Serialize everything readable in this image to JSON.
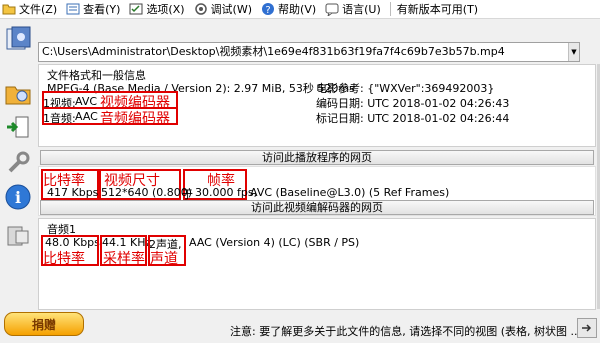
{
  "menu": {
    "file": "文件(Z)",
    "view": "查看(Y)",
    "options": "选项(X)",
    "debug": "调试(W)",
    "help": "帮助(V)",
    "language": "语言(U)",
    "update": "有新版本可用(T)"
  },
  "path": "C:\\Users\\Administrator\\Desktop\\视频素材\\1e69e4f831b63f19fa7f4c69b7e3b57b.mp4",
  "general": {
    "heading": "文件格式和一般信息",
    "format_line": "MPEG-4 (Base Media / Version 2): 2.97 MiB, 53秒 520ms",
    "movie_line": "电影参考: {\"WXVer\":369492003}",
    "video_prefix": "1视频:",
    "video_codec": "AVC",
    "video_label": "视频编码器",
    "audio_prefix": "1音频:",
    "audio_codec": "AAC",
    "audio_label": "音频编码器",
    "encoded_date": "编码日期: UTC 2018-01-02 04:26:43",
    "tagged_date": "标记日期: UTC 2018-01-02 04:26:44",
    "visit_player_button": "访问此播放程序的网页"
  },
  "video": {
    "bitrate_label": "比特率",
    "size_label": "视频尺寸",
    "framerate_label": "帧率",
    "bitrate": "417 Kbps",
    "size": "512*640 (0.800)",
    "framerate_prefix": "于",
    "framerate": "30.000 fps,",
    "codec_detail": "AVC (Baseline@L3.0) (5 Ref Frames)",
    "visit_codec_button": "访问此视频编解码器的网页"
  },
  "audio": {
    "heading": "音频1",
    "bitrate": "48.0 Kbps",
    "samplerate": "44.1 KHz",
    "channels": "2声道,",
    "codec_detail": "AAC (Version 4) (LC) (SBR / PS)",
    "bitrate_label": "比特率",
    "samplerate_label": "采样率",
    "channels_label": "声道"
  },
  "donate_label": "捐赠",
  "status_text": "注意: 要了解更多关于此文件的信息, 请选择不同的视图 (表格, 树状图 ..."
}
